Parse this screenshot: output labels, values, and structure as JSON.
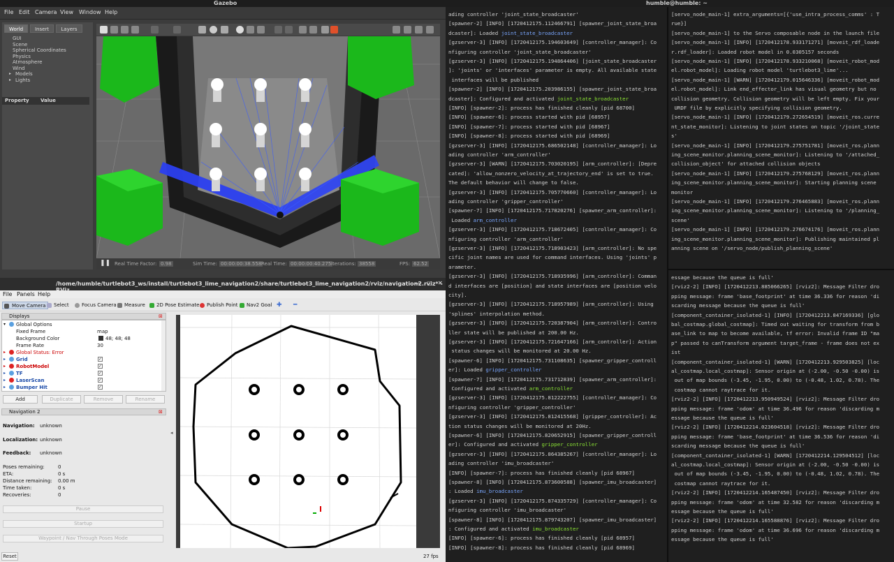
{
  "topbar": {
    "left_app": "Gazebo",
    "right_title": "humble@humble: ~"
  },
  "gazebo": {
    "menu": [
      "File",
      "Edit",
      "Camera",
      "View",
      "Window",
      "Help"
    ],
    "tabs": [
      "World",
      "Insert",
      "Layers"
    ],
    "tree": [
      "GUI",
      "Scene",
      "Spherical Coordinates",
      "Physics",
      "Atmosphere",
      "Wind",
      "Models",
      "Lights"
    ],
    "prop_headers": [
      "Property",
      "Value"
    ],
    "status": {
      "rtf_label": "Real Time Factor:",
      "rtf": "0.98",
      "sim_label": "Sim Time:",
      "sim": "00:00:00:38.558",
      "real_label": "Real Time:",
      "real": "00:00:00:40.275",
      "iter_label": "Iterations:",
      "iter": "38558",
      "fps_label": "FPS:",
      "fps": "62.52"
    }
  },
  "rviz": {
    "title": "/home/humble/turtlebot3_ws/install/turtlebot3_lime_navigation2/share/turtlebot3_lime_navigation2/rviz/navigation2.rviz* - RViz",
    "menu": [
      "File",
      "Panels",
      "Help"
    ],
    "tools": [
      "Move Camera",
      "Select",
      "Focus Camera",
      "Measure",
      "2D Pose Estimate",
      "Publish Point",
      "Nav2 Goal"
    ],
    "displays_title": "Displays",
    "displays": [
      {
        "label": "Global Options",
        "value": ""
      },
      {
        "label": "Fixed Frame",
        "value": "map"
      },
      {
        "label": "Background Color",
        "value": "48; 48; 48"
      },
      {
        "label": "Frame Rate",
        "value": "30"
      },
      {
        "label": "Global Status: Error",
        "value": ""
      },
      {
        "label": "Grid",
        "value": "✓"
      },
      {
        "label": "RobotModel",
        "value": "✓"
      },
      {
        "label": "TF",
        "value": "✓"
      },
      {
        "label": "LaserScan",
        "value": "✓"
      },
      {
        "label": "Bumper Hit",
        "value": "✓"
      }
    ],
    "display_buttons": [
      "Add",
      "Duplicate",
      "Remove",
      "Rename"
    ],
    "nav_title": "Navigation 2",
    "nav": {
      "navigation_label": "Navigation:",
      "navigation": "unknown",
      "localization_label": "Localization:",
      "localization": "unknown",
      "feedback_label": "Feedback:",
      "feedback": "unknown",
      "poses_label": "Poses remaining:",
      "poses": "0",
      "eta_label": "ETA:",
      "eta": "0 s",
      "dist_label": "Distance remaining:",
      "dist": "0.00 m",
      "time_label": "Time taken:",
      "time": "0 s",
      "rec_label": "Recoveries:",
      "rec": "0"
    },
    "nav_buttons": [
      "Pause",
      "Startup",
      "Waypoint / Nav Through Poses Mode"
    ],
    "reset": "Reset",
    "fps": "27 fps"
  },
  "term1_lines": [
    "ading controller 'joint_state_broadcaster'",
    "[spawner-2] [INFO] [1720412175.112466791] [spawner_joint_state_broa",
    "dcaster]: Loaded |b|joint_state_broadcaster",
    "[gzserver-3] [INFO] [1720412175.194603649] [controller_manager]: Co",
    "nfiguring controller 'joint_state_broadcaster'",
    "[gzserver-3] [INFO] [1720412175.194864406] [joint_state_broadcaster",
    "]: 'joints' or 'interfaces' parameter is empty. All available state",
    " interfaces will be published",
    "[spawner-2] [INFO] [1720412175.203986155] [spawner_joint_state_broa",
    "dcaster]: Configured and activated |g|joint_state_broadcaster",
    "[INFO] [spawner-2]: process has finished cleanly [pid 68700]",
    "[INFO] [spawner-6]: process started with pid [68957]",
    "[INFO] [spawner-7]: process started with pid [68967]",
    "[INFO] [spawner-8]: process started with pid [68969]",
    "[gzserver-3] [INFO] [1720412175.686502148] [controller_manager]: Lo",
    "ading controller 'arm_controller'",
    "[gzserver-3] [WARN] [1720412175.703020195] [arm_controller]: [Depre",
    "cated]: 'allow_nonzero_velocity_at_trajectory_end' is set to true.",
    "The default behavior will change to false.",
    "[gzserver-3] [INFO] [1720412175.705770660] [controller_manager]: Lo",
    "ading controller 'gripper_controller'",
    "[spawner-7] [INFO] [1720412175.717820276] [spawner_arm_controller]:",
    " Loaded |b|arm_controller",
    "[gzserver-3] [INFO] [1720412175.718672405] [controller_manager]: Co",
    "nfiguring controller 'arm_controller'",
    "[gzserver-3] [INFO] [1720412175.718903423] [arm_controller]: No spe",
    "cific joint names are used for command interfaces. Using 'joints' p",
    "arameter.",
    "[gzserver-3] [INFO] [1720412175.718935996] [arm_controller]: Comman",
    "d interfaces are [position] and state interfaces are [position velo",
    "city].",
    "[gzserver-3] [INFO] [1720412175.718957989] [arm_controller]: Using",
    "'splines' interpolation method.",
    "[gzserver-3] [INFO] [1720412175.720387904] [arm_controller]: Contro",
    "ller state will be published at 200.00 Hz.",
    "[gzserver-3] [INFO] [1720412175.721647166] [arm_controller]: Action",
    " status changes will be monitored at 20.00 Hz.",
    "[spawner-6] [INFO] [1720412175.731108635] [spawner_gripper_controll",
    "er]: Loaded |b|gripper_controller",
    "[spawner-7] [INFO] [1720412175.731712839] [spawner_arm_controller]:",
    " Configured and activated |g|arm_controller",
    "[gzserver-3] [INFO] [1720412175.812222755] [controller_manager]: Co",
    "nfiguring controller 'gripper_controller'",
    "[gzserver-3] [INFO] [1720412175.812415568] [gripper_controller]: Ac",
    "tion status changes will be monitored at 20Hz.",
    "[spawner-6] [INFO] [1720412175.820652915] [spawner_gripper_controll",
    "er]: Configured and activated |g|gripper_controller",
    "[gzserver-3] [INFO] [1720412175.864385267] [controller_manager]: Lo",
    "ading controller 'imu_broadcaster'",
    "[INFO] [spawner-7]: process has finished cleanly [pid 68967]",
    "[spawner-8] [INFO] [1720412175.873600588] [spawner_imu_broadcaster]",
    ": Loaded |b|imu_broadcaster",
    "[gzserver-3] [INFO] [1720412175.874335729] [controller_manager]: Co",
    "nfiguring controller 'imu_broadcaster'",
    "[spawner-8] [INFO] [1720412175.879743207] [spawner_imu_broadcaster]",
    ": Configured and activated |g|imu_broadcaster",
    "[INFO] [spawner-6]: process has finished cleanly [pid 68957]",
    "[INFO] [spawner-8]: process has finished cleanly [pid 68969]"
  ],
  "term2_lines": [
    "[servo_node_main-1] extra_arguments=[{'use_intra_process_comms' : T",
    "rue}]",
    "[servo_node_main-1] to the Servo composable node in the launch file",
    "[servo_node_main-1] [INFO] [1720412178.933171271] [moveit_rdf_loade",
    "r.rdf_loader]: Loaded robot model in 0.0305157 seconds",
    "[servo_node_main-1] [INFO] [1720412178.933210068] [moveit_robot_mod",
    "el.robot_model]: Loading robot model 'turtlebot3_lime'...",
    "[servo_node_main-1] [WARN] [1720412179.015646336] [moveit_robot_mod",
    "el.robot_model]: Link end_effector_link has visual geometry but no",
    "collision geometry. Collision geometry will be left empty. Fix your",
    " URDF file by explicitly specifying collision geometry.",
    "[servo_node_main-1] [INFO] [1720412179.272654519] [moveit_ros.curre",
    "nt_state_monitor]: Listening to joint states on topic '/joint_state",
    "s'",
    "[servo_node_main-1] [INFO] [1720412179.275751781] [moveit_ros.plann",
    "ing_scene_monitor.planning_scene_monitor]: Listening to '/attached_",
    "collision_object' for attached collision objects",
    "[servo_node_main-1] [INFO] [1720412179.275768129] [moveit_ros.plann",
    "ing_scene_monitor.planning_scene_monitor]: Starting planning scene",
    "monitor",
    "[servo_node_main-1] [INFO] [1720412179.276465883] [moveit_ros.plann",
    "ing_scene_monitor.planning_scene_monitor]: Listening to '/planning_",
    "scene'",
    "[servo_node_main-1] [INFO] [1720412179.276674176] [moveit_ros.plann",
    "ing_scene_monitor.planning_scene_monitor]: Publishing maintained pl",
    "anning scene on '/servo_node/publish_planning_scene'"
  ],
  "term3_lines": [
    "essage because the queue is full'",
    "[rviz2-2] [INFO] [1720412213.885066265] [rviz2]: Message Filter dro",
    "pping message: frame 'base_footprint' at time 36.336 for reason 'di",
    "scarding message because the queue is full'",
    "[component_container_isolated-1] [INFO] [1720412213.847169336] [glo",
    "bal_costmap.global_costmap]: Timed out waiting for transform from b",
    "ase_link to map to become available, tf error: Invalid frame ID \"ma",
    "p\" passed to canTransform argument target_frame - frame does not ex",
    "ist",
    "[component_container_isolated-1] [WARN] [1720412213.929503825] [loc",
    "al_costmap.local_costmap]: Sensor origin at (-2.00, -0.50 -0.00) is",
    " out of map bounds (-3.45, -1.95, 0.00) to (-0.48, 1.02, 0.78). The",
    " costmap cannot raytrace for it.",
    "[rviz2-2] [INFO] [1720412213.950949524] [rviz2]: Message Filter dro",
    "pping message: frame 'odom' at time 36.496 for reason 'discarding m",
    "essage because the queue is full'",
    "[rviz2-2] [INFO] [1720412214.023604518] [rviz2]: Message Filter dro",
    "pping message: frame 'base_footprint' at time 36.536 for reason 'di",
    "scarding message because the queue is full'",
    "[component_container_isolated-1] [WARN] [1720412214.129504512] [loc",
    "al_costmap.local_costmap]: Sensor origin at (-2.00, -0.50 -0.00) is",
    " out of map bounds (-3.45, -1.95, 0.00) to (-0.48, 1.02, 0.78). The",
    " costmap cannot raytrace for it.",
    "[rviz2-2] [INFO] [1720412214.165487450] [rviz2]: Message Filter dro",
    "pping message: frame 'odom' at time 32.582 for reason 'discarding m",
    "essage because the queue is full'",
    "[rviz2-2] [INFO] [1720412214.165588876] [rviz2]: Message Filter dro",
    "pping message: frame 'odom' at time 36.696 for reason 'discarding m",
    "essage because the queue is full'"
  ]
}
